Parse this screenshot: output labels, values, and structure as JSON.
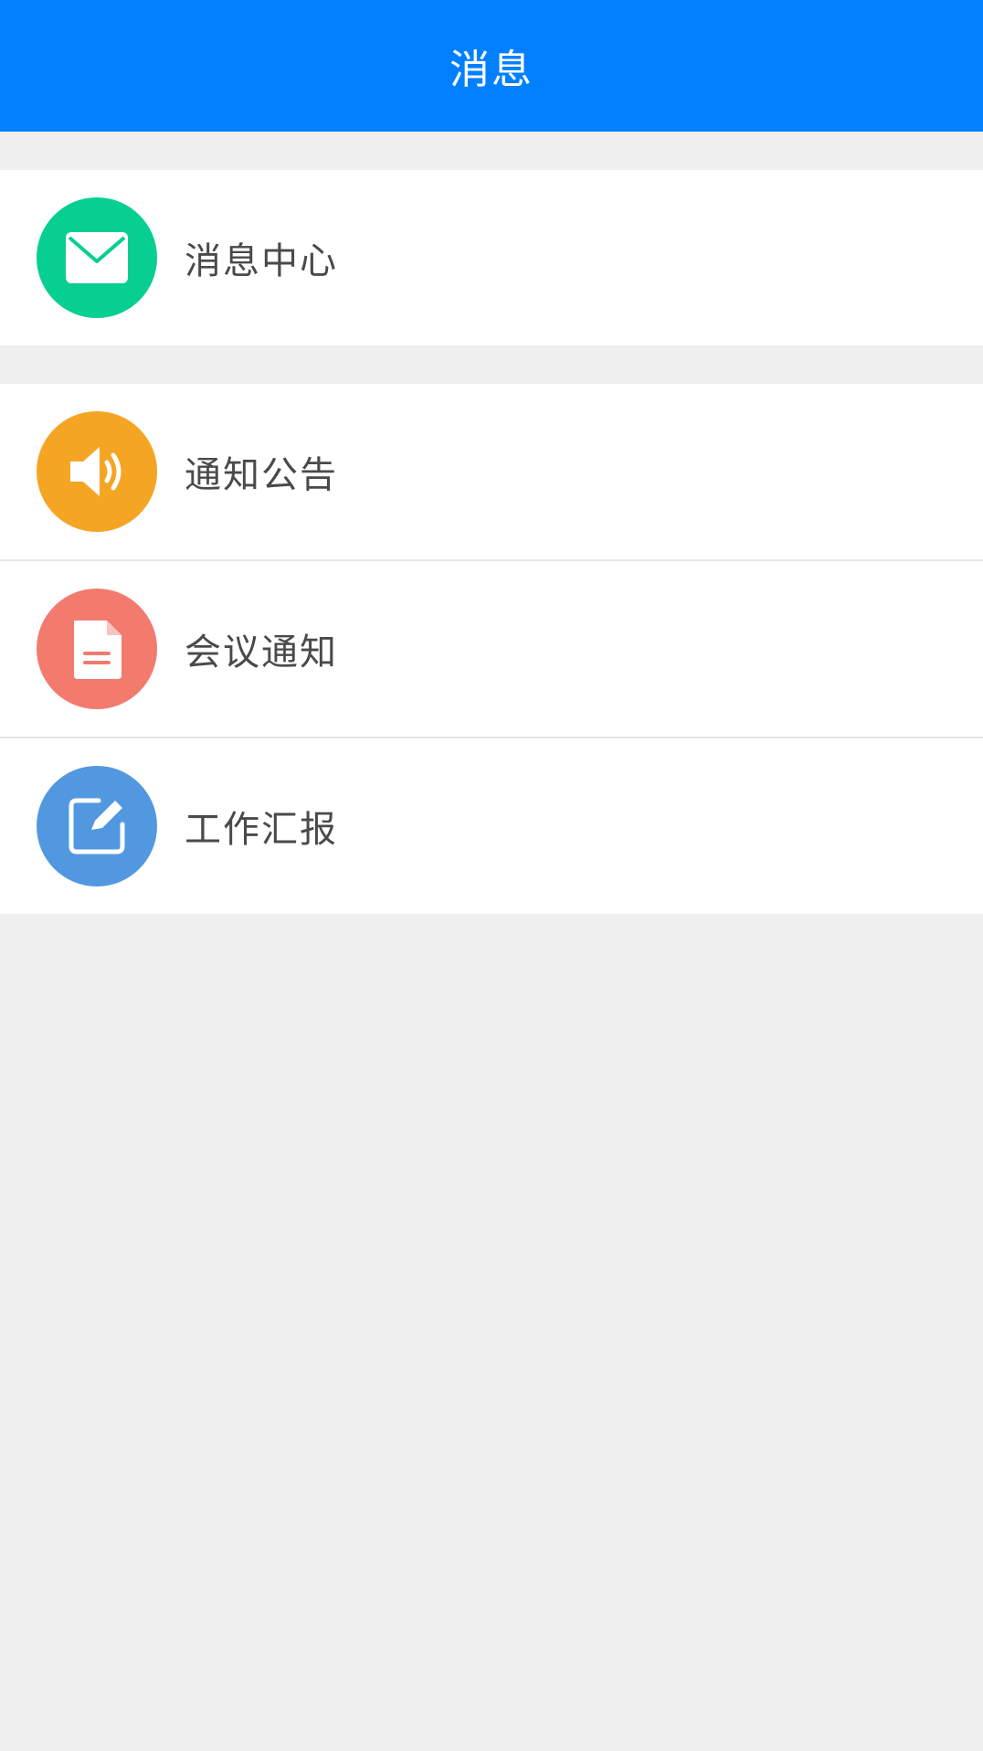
{
  "header": {
    "title": "消息"
  },
  "groups": [
    {
      "items": [
        {
          "label": "消息中心",
          "icon": "envelope-icon",
          "color": "#07cf92"
        }
      ]
    },
    {
      "items": [
        {
          "label": "通知公告",
          "icon": "speaker-icon",
          "color": "#f5a524"
        },
        {
          "label": "会议通知",
          "icon": "document-icon",
          "color": "#f27b6e"
        },
        {
          "label": "工作汇报",
          "icon": "edit-icon",
          "color": "#5298e0"
        }
      ]
    }
  ]
}
